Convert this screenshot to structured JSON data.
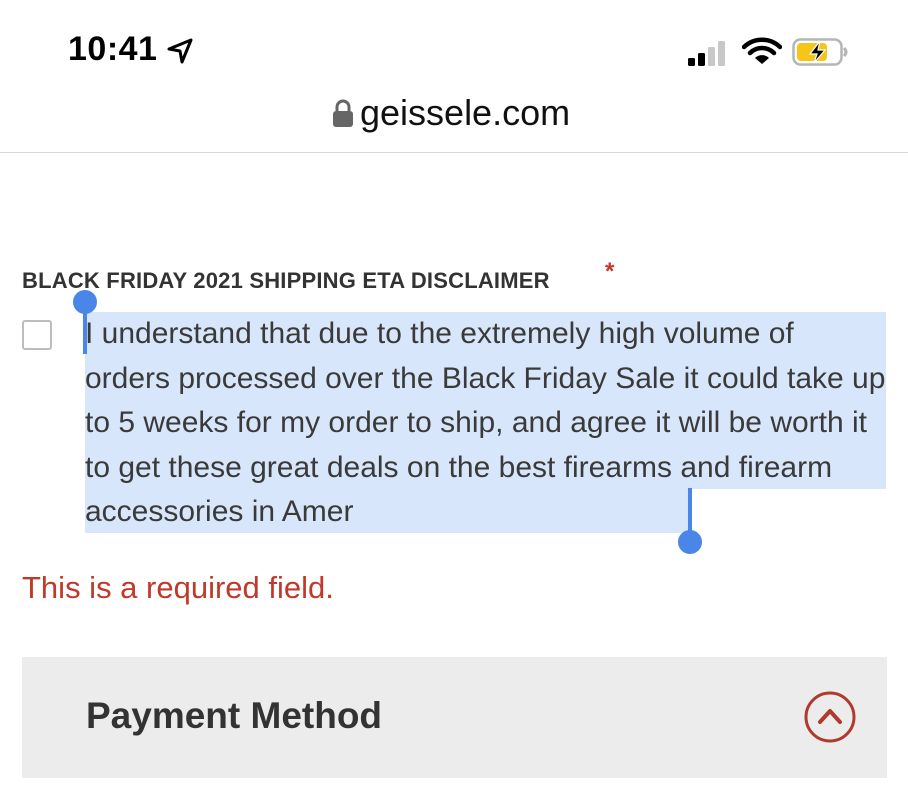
{
  "status_bar": {
    "time": "10:41",
    "icons": [
      "location-arrow-icon",
      "cellular-signal-icon",
      "wifi-icon",
      "battery-charging-icon"
    ]
  },
  "browser": {
    "url": "geissele.com",
    "secure_icon": "lock-icon"
  },
  "disclaimer": {
    "title": "BLACK FRIDAY 2021 SHIPPING ETA DISCLAIMER",
    "required_marker": "*",
    "checked": false,
    "text": "I understand that due to the extremely high volume of orders processed over the Black Friday Sale it could take up to 5 weeks for my order to ship, and agree it will be worth it to get these great deals on the best firearms and firearm accessories in Amer",
    "error": "This is a required field."
  },
  "payment": {
    "title": "Payment Method",
    "toggle_icon": "chevron-up-circle-icon"
  },
  "colors": {
    "error": "#c0392b",
    "selection": "#d8e6fb",
    "selection_handle": "#4a86e8",
    "section_bg": "#ececec"
  }
}
